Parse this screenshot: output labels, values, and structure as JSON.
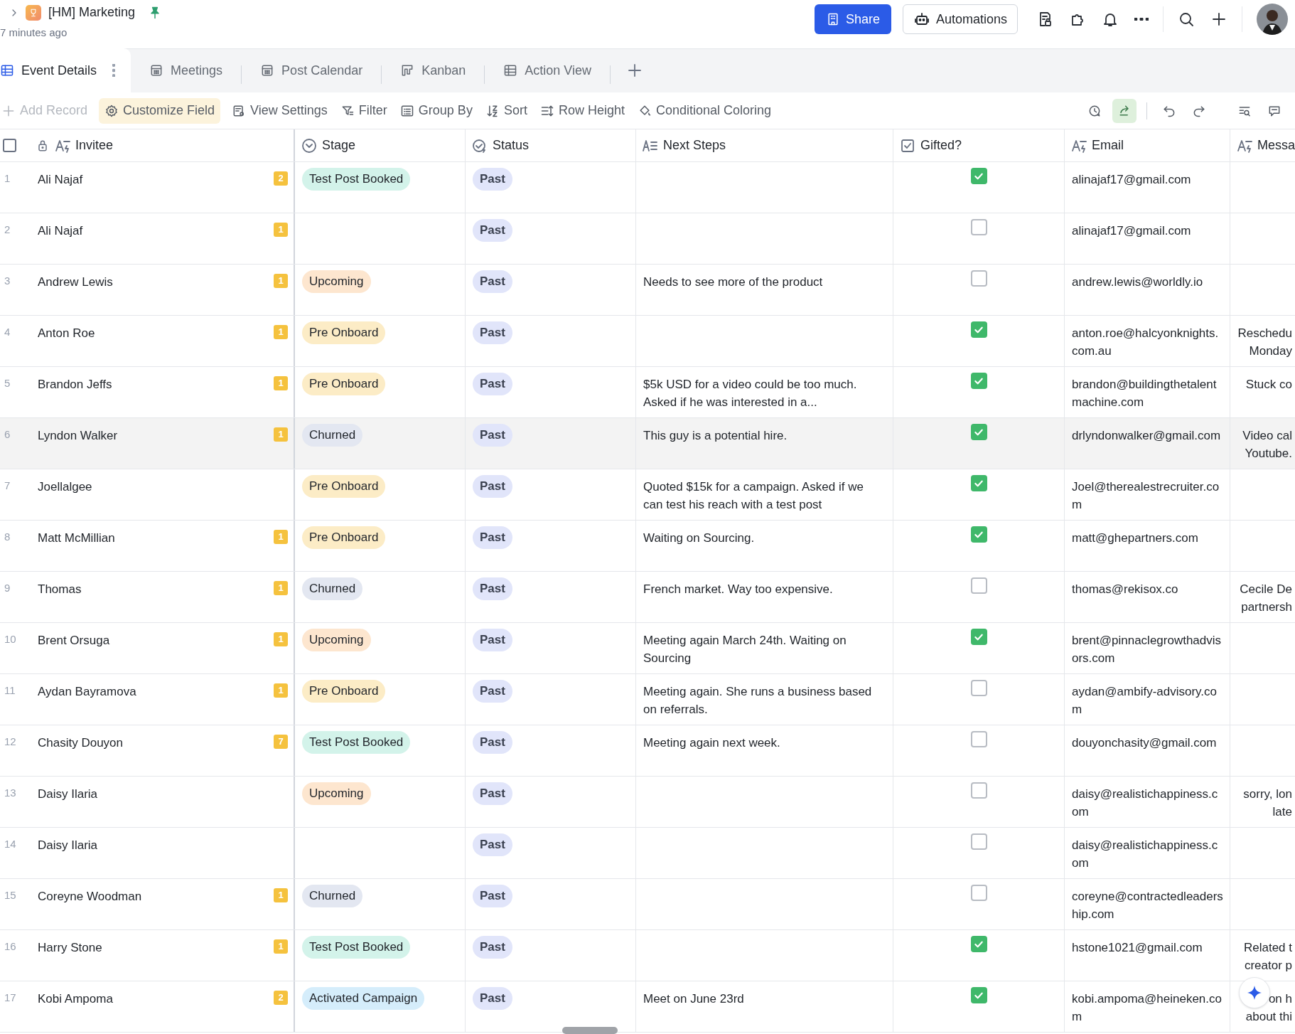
{
  "header": {
    "title": "[HM] Marketing",
    "subtitle": "7 minutes ago",
    "share": "Share",
    "automations": "Automations"
  },
  "tabs": [
    {
      "kind": "grid",
      "label": "Event Details",
      "selected": true
    },
    {
      "kind": "calendar",
      "label": "Meetings",
      "selected": false
    },
    {
      "kind": "calendar",
      "label": "Post Calendar",
      "selected": false
    },
    {
      "kind": "kanban",
      "label": "Kanban",
      "selected": false
    },
    {
      "kind": "grid",
      "label": "Action View",
      "selected": false
    }
  ],
  "toolbar": [
    {
      "kind": "add",
      "label": "Add Record",
      "disabled": true,
      "highlighted": false
    },
    {
      "kind": "customize",
      "label": "Customize Field",
      "disabled": false,
      "highlighted": true
    },
    {
      "kind": "view",
      "label": "View Settings",
      "disabled": false,
      "highlighted": false
    },
    {
      "kind": "filter",
      "label": "Filter",
      "disabled": false,
      "highlighted": false
    },
    {
      "kind": "group",
      "label": "Group By",
      "disabled": false,
      "highlighted": false
    },
    {
      "kind": "sort",
      "label": "Sort",
      "disabled": false,
      "highlighted": false
    },
    {
      "kind": "height",
      "label": "Row Height",
      "disabled": false,
      "highlighted": false
    },
    {
      "kind": "coloring",
      "label": "Conditional Coloring",
      "disabled": false,
      "highlighted": false
    }
  ],
  "toolbar_icons": [
    {
      "kind": "history",
      "active": false
    },
    {
      "kind": "share",
      "active": true
    },
    {
      "kind": "undo",
      "active": false
    },
    {
      "kind": "redo",
      "active": false
    },
    {
      "kind": "find",
      "active": false
    },
    {
      "kind": "comment",
      "active": false
    }
  ],
  "select_all": {
    "checked": false
  },
  "columns": [
    {
      "kind": "text",
      "label": "Invitee"
    },
    {
      "kind": "select",
      "label": "Stage"
    },
    {
      "kind": "status",
      "label": "Status"
    },
    {
      "kind": "longtext",
      "label": "Next Steps"
    },
    {
      "kind": "check",
      "label": "Gifted?"
    },
    {
      "kind": "text",
      "label": "Email"
    },
    {
      "kind": "text",
      "label": "Messa"
    }
  ],
  "rows": [
    {
      "number": "1",
      "invitee": "Ali Najaf",
      "count": "2",
      "stage": {
        "label": "Test Post Booked",
        "color": "#d3f3ea"
      },
      "status": "Past",
      "gifted": true,
      "email": "alinajaf17@gmail.com",
      "hovered": false
    },
    {
      "number": "2",
      "invitee": "Ali Najaf",
      "count": "1",
      "status": "Past",
      "gifted": false,
      "email": "alinajaf17@gmail.com",
      "hovered": false
    },
    {
      "number": "3",
      "invitee": "Andrew Lewis",
      "count": "1",
      "stage": {
        "label": "Upcoming",
        "color": "#fde6cf"
      },
      "status": "Past",
      "next_steps": "Needs to see more of the product",
      "gifted": false,
      "email": "andrew.lewis@worldly.io",
      "hovered": false
    },
    {
      "number": "4",
      "invitee": "Anton Roe",
      "count": "1",
      "stage": {
        "label": "Pre Onboard",
        "color": "#fcecc6"
      },
      "status": "Past",
      "gifted": true,
      "email": "anton.roe@halcyonknights.com.au",
      "message": [
        "Reschedu",
        "Monday"
      ],
      "hovered": false
    },
    {
      "number": "5",
      "invitee": "Brandon Jeffs",
      "count": "1",
      "stage": {
        "label": "Pre Onboard",
        "color": "#fcecc6"
      },
      "status": "Past",
      "next_steps": "$5k USD for a video could be too much. Asked if he was interested in a...",
      "gifted": true,
      "email": "brandon@buildingthetalentmachine.com",
      "message": [
        "Stuck co"
      ],
      "hovered": false
    },
    {
      "number": "6",
      "invitee": "Lyndon Walker",
      "count": "1",
      "stage": {
        "label": "Churned",
        "color": "#e3e7f1"
      },
      "status": "Past",
      "next_steps": "This guy is a potential hire.",
      "gifted": true,
      "email": "drlyndonwalker@gmail.com",
      "message": [
        "Video cal",
        "Youtube."
      ],
      "hovered": true
    },
    {
      "number": "7",
      "invitee": "Joellalgee",
      "stage": {
        "label": "Pre Onboard",
        "color": "#fcecc6"
      },
      "status": "Past",
      "next_steps": "Quoted $15k for a campaign. Asked if we can test his reach with a test post",
      "gifted": true,
      "email": "Joel@therealestrecruiter.com",
      "hovered": false
    },
    {
      "number": "8",
      "invitee": "Matt McMillian",
      "count": "1",
      "stage": {
        "label": "Pre Onboard",
        "color": "#fcecc6"
      },
      "status": "Past",
      "next_steps": "Waiting on Sourcing.",
      "gifted": true,
      "email": "matt@ghepartners.com",
      "hovered": false
    },
    {
      "number": "9",
      "invitee": "Thomas",
      "count": "1",
      "stage": {
        "label": "Churned",
        "color": "#e3e7f1"
      },
      "status": "Past",
      "next_steps": "French market. Way too expensive.",
      "gifted": false,
      "email": "thomas@rekisox.co",
      "message": [
        "Cecile De",
        "partnersh"
      ],
      "hovered": false
    },
    {
      "number": "10",
      "invitee": "Brent Orsuga",
      "count": "1",
      "stage": {
        "label": "Upcoming",
        "color": "#fde6cf"
      },
      "status": "Past",
      "next_steps": "Meeting again March 24th. Waiting on Sourcing",
      "gifted": true,
      "email": "brent@pinnaclegrowthadvisors.com",
      "hovered": false
    },
    {
      "number": "11",
      "invitee": "Aydan Bayramova",
      "count": "1",
      "stage": {
        "label": "Pre Onboard",
        "color": "#fcecc6"
      },
      "status": "Past",
      "next_steps": "Meeting again. She runs a business based on referrals.",
      "gifted": false,
      "email": "aydan@ambify-advisory.com",
      "hovered": false
    },
    {
      "number": "12",
      "invitee": "Chasity Douyon",
      "count": "7",
      "stage": {
        "label": "Test Post Booked",
        "color": "#d3f3ea"
      },
      "status": "Past",
      "next_steps": "Meeting again next week.",
      "gifted": false,
      "email": "douyonchasity@gmail.com",
      "hovered": false
    },
    {
      "number": "13",
      "invitee": "Daisy Ilaria",
      "stage": {
        "label": "Upcoming",
        "color": "#fde6cf"
      },
      "status": "Past",
      "gifted": false,
      "email": "daisy@realistichappiness.com",
      "message": [
        "sorry, lon",
        "late"
      ],
      "hovered": false
    },
    {
      "number": "14",
      "invitee": "Daisy Ilaria",
      "status": "Past",
      "gifted": false,
      "email": "daisy@realistichappiness.com",
      "hovered": false
    },
    {
      "number": "15",
      "invitee": "Coreyne Woodman",
      "count": "1",
      "stage": {
        "label": "Churned",
        "color": "#e3e7f1"
      },
      "status": "Past",
      "gifted": false,
      "email": "coreyne@contractedleadership.com",
      "hovered": false
    },
    {
      "number": "16",
      "invitee": "Harry Stone",
      "count": "1",
      "stage": {
        "label": "Test Post Booked",
        "color": "#d3f3ea"
      },
      "status": "Past",
      "gifted": true,
      "email": "hstone1021@gmail.com",
      "message": [
        "Related t",
        "creator p"
      ],
      "hovered": false
    },
    {
      "number": "17",
      "invitee": "Kobi Ampoma",
      "count": "2",
      "stage": {
        "label": "Activated Campaign",
        "color": "#d5edfb"
      },
      "status": "Past",
      "next_steps": "Meet on June 23rd",
      "gifted": true,
      "email": "kobi.ampoma@heineken.com",
      "message": [
        "on h",
        "about thi"
      ],
      "hovered": false
    }
  ]
}
